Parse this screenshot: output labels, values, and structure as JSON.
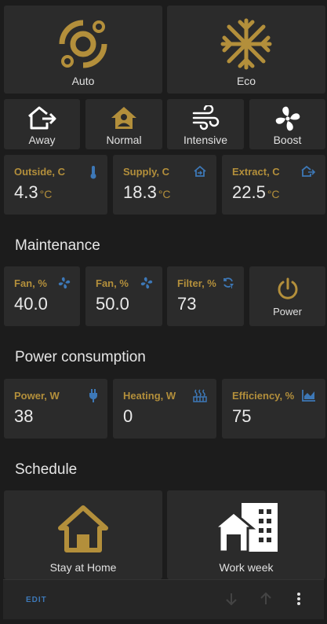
{
  "presets": [
    {
      "label": "Auto",
      "icon": "auto-mode-icon"
    },
    {
      "label": "Eco",
      "icon": "snowflake-icon"
    }
  ],
  "modes": [
    {
      "label": "Away",
      "icon": "home-export-icon"
    },
    {
      "label": "Normal",
      "icon": "home-account-icon"
    },
    {
      "label": "Intensive",
      "icon": "wind-icon"
    },
    {
      "label": "Boost",
      "icon": "fan-icon"
    }
  ],
  "temperatures": [
    {
      "title": "Outside, C",
      "value": "4.3",
      "unit": "°C",
      "icon": "thermometer-icon"
    },
    {
      "title": "Supply, C",
      "value": "18.3",
      "unit": "°C",
      "icon": "home-import-icon"
    },
    {
      "title": "Extract, C",
      "value": "22.5",
      "unit": "°C",
      "icon": "home-export-icon"
    }
  ],
  "maintenance": {
    "title": "Maintenance",
    "items": [
      {
        "title": "Fan, %",
        "value": "40.0",
        "icon": "fan-icon"
      },
      {
        "title": "Fan, %",
        "value": "50.0",
        "icon": "fan-icon"
      },
      {
        "title": "Filter, %",
        "value": "73",
        "icon": "filter-refresh-icon"
      }
    ],
    "power_label": "Power"
  },
  "power_consumption": {
    "title": "Power consumption",
    "items": [
      {
        "title": "Power, W",
        "value": "38",
        "icon": "plug-icon"
      },
      {
        "title": "Heating, W",
        "value": "0",
        "icon": "heater-icon"
      },
      {
        "title": "Efficiency, %",
        "value": "75",
        "icon": "area-chart-icon"
      }
    ]
  },
  "schedule": {
    "title": "Schedule",
    "items": [
      {
        "label": "Stay at Home",
        "icon": "home-icon"
      },
      {
        "label": "Work week",
        "icon": "office-building-icon"
      }
    ]
  },
  "footer": {
    "edit_label": "EDIT"
  },
  "colors": {
    "gold": "#b38f3b",
    "blue": "#3d78b7",
    "card": "#2b2b2b",
    "background": "#1c1c1c"
  }
}
